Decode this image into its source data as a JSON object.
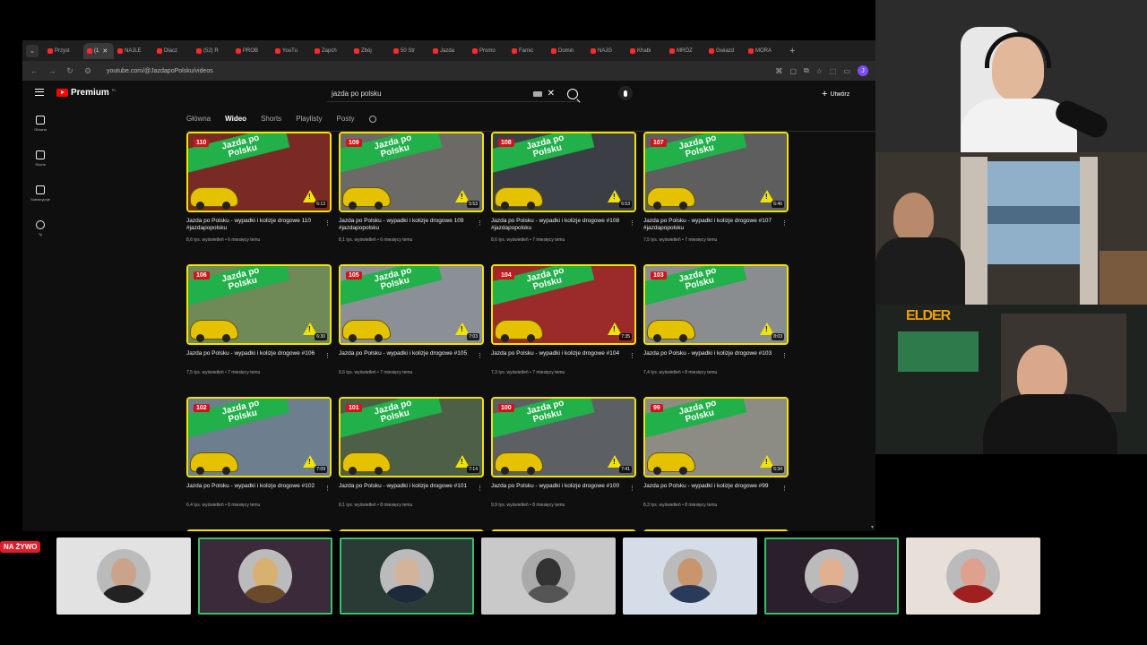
{
  "browser": {
    "tabs": [
      "Przyst",
      "(1",
      "NAJLE",
      "Dlacz",
      "(52) R",
      "PROB",
      "YouTu",
      "Zapch",
      "Zbój",
      "50 Str",
      "Jazda",
      "Promo",
      "Famic",
      "Domin",
      "NAJG",
      "Khabi",
      "MRÓZ",
      "Gwiazd",
      "MORA"
    ],
    "url": "youtube.com/@JazdapoPolsku/videos",
    "profile_initial": "J"
  },
  "youtube": {
    "logo": "Premium",
    "logo_sup": "PL",
    "search_value": "jazda po polsku",
    "create_label": "Utwórz",
    "sidebar": [
      {
        "label": "Główna",
        "icon": "home-icon"
      },
      {
        "label": "Shorts",
        "icon": "shorts-icon"
      },
      {
        "label": "Subskrypcje",
        "icon": "subscriptions-icon"
      },
      {
        "label": "Ty",
        "icon": "account-icon"
      }
    ],
    "channel_tabs": [
      "Główna",
      "Wideo",
      "Shorts",
      "Playlisty",
      "Posty"
    ],
    "active_tab": "Wideo",
    "thumb_label": "Jazda po\nPolsku",
    "videos": [
      {
        "ep": "110",
        "title": "Jazda po Polsku - wypadki i kolizje drogowe 110 #jazdapopolsku",
        "meta": "8,6 tys. wyświetleń • 6 miesięcy temu",
        "dur": "6:13",
        "bg": "#7a2a25"
      },
      {
        "ep": "109",
        "title": "Jazda po Polsku - wypadki i kolizje drogowe 109 #jazdapopolsku",
        "meta": "8,1 tys. wyświetleń • 6 miesięcy temu",
        "dur": "5:53",
        "bg": "#6c6a66"
      },
      {
        "ep": "108",
        "title": "Jazda po Polsku - wypadki i kolizje drogowe #108 #jazdapopolsku",
        "meta": "8,6 tys. wyświetleń • 7 miesięcy temu",
        "dur": "6:53",
        "bg": "#3b3f45"
      },
      {
        "ep": "107",
        "title": "Jazda po Polsku - wypadki i kolizje drogowe #107 #jazdapopolsku",
        "meta": "7,5 tys. wyświetleń • 7 miesięcy temu",
        "dur": "6:46",
        "bg": "#5e5e5e"
      },
      {
        "ep": "106",
        "title": "Jazda po Polsku - wypadki i kolizje drogowe #106",
        "meta": "7,5 tys. wyświetleń • 7 miesięcy temu",
        "dur": "6:30",
        "bg": "#6f8a57"
      },
      {
        "ep": "105",
        "title": "Jazda po Polsku - wypadki i kolizje drogowe #105",
        "meta": "6,6 tys. wyświetleń • 7 miesięcy temu",
        "dur": "7:03",
        "bg": "#8b8f96"
      },
      {
        "ep": "104",
        "title": "Jazda po Polsku - wypadki i kolizje drogowe #104",
        "meta": "7,3 tys. wyświetleń • 7 miesięcy temu",
        "dur": "7:35",
        "bg": "#9b2a2a"
      },
      {
        "ep": "103",
        "title": "Jazda po Polsku - wypadki i kolizje drogowe #103",
        "meta": "7,4 tys. wyświetleń • 8 miesięcy temu",
        "dur": "8:03",
        "bg": "#8a8d90"
      },
      {
        "ep": "102",
        "title": "Jazda po Polsku - wypadki i kolizje drogowe #102",
        "meta": "6,4 tys. wyświetleń • 8 miesięcy temu",
        "dur": "7:09",
        "bg": "#6d7e8f"
      },
      {
        "ep": "101",
        "title": "Jazda po Polsku - wypadki i kolizje drogowe #101",
        "meta": "8,1 tys. wyświetleń • 8 miesięcy temu",
        "dur": "7:14",
        "bg": "#4e5f48"
      },
      {
        "ep": "100",
        "title": "Jazda po Polsku - wypadki i kolizje drogowe #100",
        "meta": "9,9 tys. wyświetleń • 8 miesięcy temu",
        "dur": "7:41",
        "bg": "#5c5f64"
      },
      {
        "ep": "99",
        "title": "Jazda po Polsku - wypadki i kolizje drogowe #99",
        "meta": "8,3 tys. wyświetleń • 8 miesięcy temu",
        "dur": "6:34",
        "bg": "#8c8c84"
      },
      {
        "ep": "",
        "title": "",
        "meta": "",
        "dur": "",
        "bg": "#5a5a5a"
      },
      {
        "ep": "",
        "title": "",
        "meta": "",
        "dur": "",
        "bg": "#5a5a5a"
      },
      {
        "ep": "",
        "title": "",
        "meta": "",
        "dur": "",
        "bg": "#5a5a5a"
      },
      {
        "ep": "",
        "title": "",
        "meta": "",
        "dur": "",
        "bg": "#5a5a5a"
      }
    ]
  },
  "overlay": {
    "cam3_label": "ELDER",
    "live_badge": "NA ŻYWO",
    "participants": [
      {
        "tile": "#e2e2e2",
        "skin": "#c9a48a",
        "shirt": "#222",
        "hl": false
      },
      {
        "tile": "#3a2a3a",
        "skin": "#d8b070",
        "shirt": "#6b4a2a",
        "hl": true
      },
      {
        "tile": "#2a3a34",
        "skin": "#d3b39a",
        "shirt": "#1d2a3a",
        "hl": true
      },
      {
        "tile": "#c9c9c9",
        "skin": "#333",
        "shirt": "#555",
        "hl": false
      },
      {
        "tile": "#d5dde8",
        "skin": "#c9956d",
        "shirt": "#2a3a5a",
        "hl": false
      },
      {
        "tile": "#2a1f2a",
        "skin": "#e0b090",
        "shirt": "#3a2a3a",
        "hl": true
      },
      {
        "tile": "#e8e0d8",
        "skin": "#e0a090",
        "shirt": "#a02020",
        "hl": false
      }
    ]
  }
}
